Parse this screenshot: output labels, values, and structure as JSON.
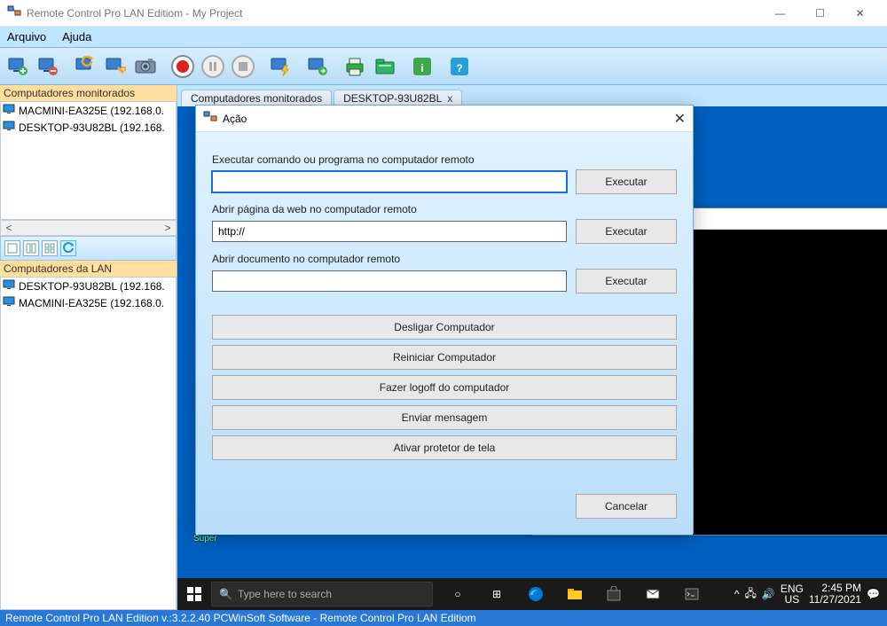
{
  "window": {
    "title": "Remote Control Pro LAN Editiom - My Project"
  },
  "menu": {
    "arquivo": "Arquivo",
    "ajuda": "Ajuda"
  },
  "sidebar": {
    "monitored_head": "Computadores monitorados",
    "monitored": [
      "MACMINI-EA325E (192.168.0.",
      "DESKTOP-93U82BL (192.168."
    ],
    "lan_head": "Computadores da LAN",
    "lan": [
      "DESKTOP-93U82BL (192.168.",
      "MACMINI-EA325E (192.168.0."
    ]
  },
  "tabs": {
    "tab1": "Computadores monitorados",
    "tab2": "DESKTOP-93U82BL",
    "tab2_close": "x"
  },
  "remote": {
    "badge": "Super",
    "win_min": "—",
    "win_max": "☐",
    "win_close": "✕",
    "search_placeholder": "Type here to search",
    "lang1": "ENG",
    "lang2": "US",
    "time": "2:45 PM",
    "date": "11/27/2021"
  },
  "modal": {
    "title": "Ação",
    "label_cmd": "Executar comando ou programa no computador remoto",
    "label_web": "Abrir página da web no computador remoto",
    "web_value": "http://",
    "label_doc": "Abrir documento no computador remoto",
    "btn_exec": "Executar",
    "btn_shutdown": "Desligar Computador",
    "btn_restart": "Reiniciar Computador",
    "btn_logoff": "Fazer logoff do computador",
    "btn_msg": "Enviar mensagem",
    "btn_saver": "Ativar protetor de tela",
    "btn_cancel": "Cancelar"
  },
  "status": {
    "text": "Remote Control Pro LAN Edition v.:3.2.2.40 PCWinSoft Software - Remote Control Pro LAN Editiom"
  }
}
